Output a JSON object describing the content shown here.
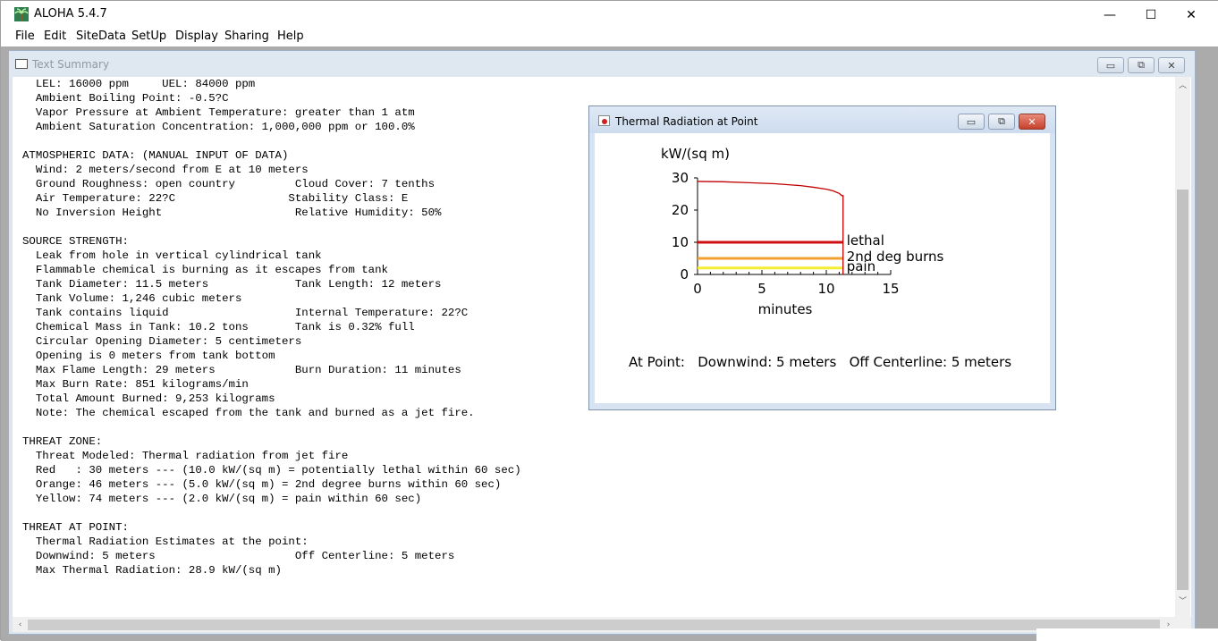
{
  "app": {
    "title": "ALOHA 5.4.7",
    "icon": "palm-tree-icon",
    "caption_buttons": {
      "minimize": "—",
      "maximize": "☐",
      "close": "✕"
    }
  },
  "menu": [
    "File",
    "Edit",
    "SiteData",
    "SetUp",
    "Display",
    "Sharing",
    "Help"
  ],
  "text_summary": {
    "title": "Text Summary",
    "lines": [
      "  LEL: 16000 ppm     UEL: 84000 ppm",
      "  Ambient Boiling Point: -0.5?C",
      "  Vapor Pressure at Ambient Temperature: greater than 1 atm",
      "  Ambient Saturation Concentration: 1,000,000 ppm or 100.0%",
      "",
      "ATMOSPHERIC DATA: (MANUAL INPUT OF DATA)",
      "  Wind: 2 meters/second from E at 10 meters",
      "  Ground Roughness: open country         Cloud Cover: 7 tenths",
      "  Air Temperature: 22?C                 Stability Class: E",
      "  No Inversion Height                    Relative Humidity: 50%",
      "",
      "SOURCE STRENGTH:",
      "  Leak from hole in vertical cylindrical tank",
      "  Flammable chemical is burning as it escapes from tank",
      "  Tank Diameter: 11.5 meters             Tank Length: 12 meters",
      "  Tank Volume: 1,246 cubic meters",
      "  Tank contains liquid                   Internal Temperature: 22?C",
      "  Chemical Mass in Tank: 10.2 tons       Tank is 0.32% full",
      "  Circular Opening Diameter: 5 centimeters",
      "  Opening is 0 meters from tank bottom",
      "  Max Flame Length: 29 meters            Burn Duration: 11 minutes",
      "  Max Burn Rate: 851 kilograms/min",
      "  Total Amount Burned: 9,253 kilograms",
      "  Note: The chemical escaped from the tank and burned as a jet fire.",
      "",
      "THREAT ZONE:",
      "  Threat Modeled: Thermal radiation from jet fire",
      "  Red   : 30 meters --- (10.0 kW/(sq m) = potentially lethal within 60 sec)",
      "  Orange: 46 meters --- (5.0 kW/(sq m) = 2nd degree burns within 60 sec)",
      "  Yellow: 74 meters --- (2.0 kW/(sq m) = pain within 60 sec)",
      "",
      "THREAT AT POINT:",
      "  Thermal Radiation Estimates at the point:",
      "  Downwind: 5 meters                     Off Centerline: 5 meters",
      "  Max Thermal Radiation: 28.9 kW/(sq m)"
    ]
  },
  "thermal_window": {
    "title": "Thermal Radiation at Point",
    "at_point_text": "At Point:   Downwind: 5 meters   Off Centerline: 5 meters"
  },
  "chart_data": {
    "type": "line",
    "title": "",
    "ylabel": "kW/(sq m)",
    "xlabel": "minutes",
    "xlim": [
      0,
      15
    ],
    "ylim": [
      0,
      30
    ],
    "x_ticks": [
      0,
      5,
      10,
      15
    ],
    "y_ticks": [
      0,
      10,
      20,
      30
    ],
    "series": [
      {
        "color": "#c00000",
        "x": [
          0,
          2,
          4,
          6,
          8,
          9,
          10,
          10.5,
          11,
          11.2,
          11.3,
          11.3
        ],
        "y": [
          28.9,
          28.8,
          28.5,
          28.2,
          27.6,
          27.1,
          26.5,
          26.0,
          25.2,
          24.5,
          24.5,
          0
        ]
      }
    ],
    "thresholds": [
      {
        "label": "lethal",
        "value": 10,
        "color": "#d01010"
      },
      {
        "label": "2nd deg burns",
        "value": 5,
        "color": "#f0a030"
      },
      {
        "label": "pain",
        "value": 2,
        "color": "#f4ee30"
      }
    ],
    "threshold_x_end": 11.3
  },
  "colors": {
    "mdi_background": "#ababab",
    "window_frame": "#d7e3f1",
    "close_button": "#c6402b"
  }
}
